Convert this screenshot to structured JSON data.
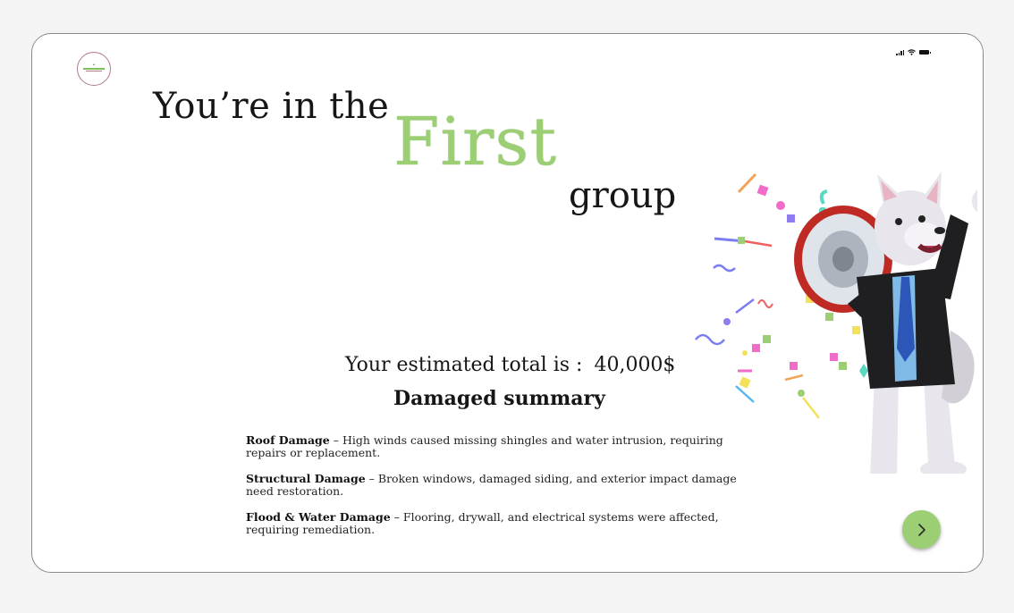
{
  "hero": {
    "line1": "You’re in the",
    "highlight": "First",
    "line3": "group"
  },
  "estimate": {
    "label": "Your estimated total is :",
    "amount": "40,000$"
  },
  "summary": {
    "title": "Damaged summary",
    "items": [
      {
        "title": "Roof Damage",
        "text": " – High winds caused missing shingles and water intrusion, requiring repairs or replacement."
      },
      {
        "title": "Structural Damage",
        "text": " – Broken windows, damaged siding, and exterior impact damage need restoration."
      },
      {
        "title": "Flood & Water Damage",
        "text": " – Flooring, drywall, and electrical systems were affected, requiring remediation."
      }
    ]
  },
  "icons": {
    "logo": "brand-logo",
    "signal": "cellular-signal-icon",
    "wifi": "wifi-icon",
    "battery": "battery-icon",
    "next": "chevron-right-icon",
    "mascot": "wolf-mascot-with-megaphone"
  },
  "colors": {
    "accent": "#9ccf74",
    "background": "#ffffff",
    "page": "#f4f4f4",
    "text": "#161616"
  }
}
